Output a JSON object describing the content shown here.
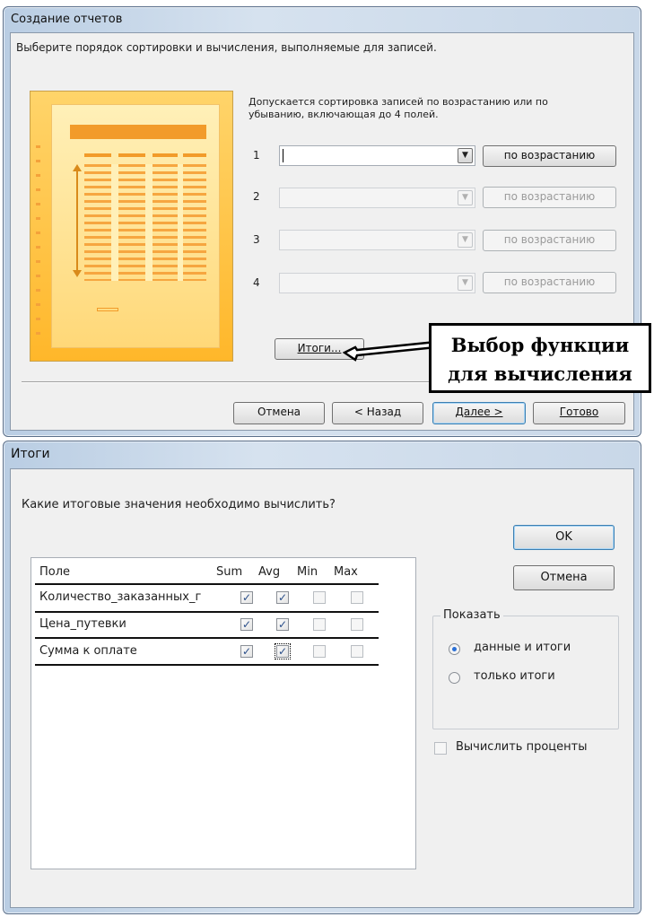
{
  "wizard": {
    "title": "Создание отчетов",
    "instruction": "Выберите порядок сортировки и вычисления, выполняемые для записей.",
    "description_line1": "Допускается сортировка записей по возрастанию или по",
    "description_line2": "убыванию, включающая до 4 полей.",
    "sort_rows": [
      {
        "num": "1",
        "field_value": "",
        "order_label": "по возрастанию",
        "enabled": true
      },
      {
        "num": "2",
        "field_value": "",
        "order_label": "по возрастанию",
        "enabled": false
      },
      {
        "num": "3",
        "field_value": "",
        "order_label": "по возрастанию",
        "enabled": false
      },
      {
        "num": "4",
        "field_value": "",
        "order_label": "по возрастанию",
        "enabled": false
      }
    ],
    "totals_button": "Итоги...",
    "buttons": {
      "cancel": "Отмена",
      "back": "< Назад",
      "next": "Далее >",
      "finish": "Готово"
    }
  },
  "callout": {
    "line1": "Выбор функции",
    "line2": "для вычисления"
  },
  "totals_dialog": {
    "title": "Итоги",
    "question": "Какие итоговые значения необходимо вычислить?",
    "columns": {
      "field": "Поле",
      "sum": "Sum",
      "avg": "Avg",
      "min": "Min",
      "max": "Max"
    },
    "rows": [
      {
        "field": "Количество_заказанных_г",
        "sum": true,
        "avg": true,
        "min": false,
        "max": false
      },
      {
        "field": "Цена_путевки",
        "sum": true,
        "avg": true,
        "min": false,
        "max": false
      },
      {
        "field": "Сумма к оплате",
        "sum": true,
        "avg": true,
        "min": false,
        "max": false
      }
    ],
    "ok": "OK",
    "cancel": "Отмена",
    "show_group": "Показать",
    "radio_detail": "данные и итоги",
    "radio_summary": "только итоги",
    "percent_checkbox": "Вычислить проценты",
    "percent_checked": false,
    "selected_show": "detail"
  }
}
